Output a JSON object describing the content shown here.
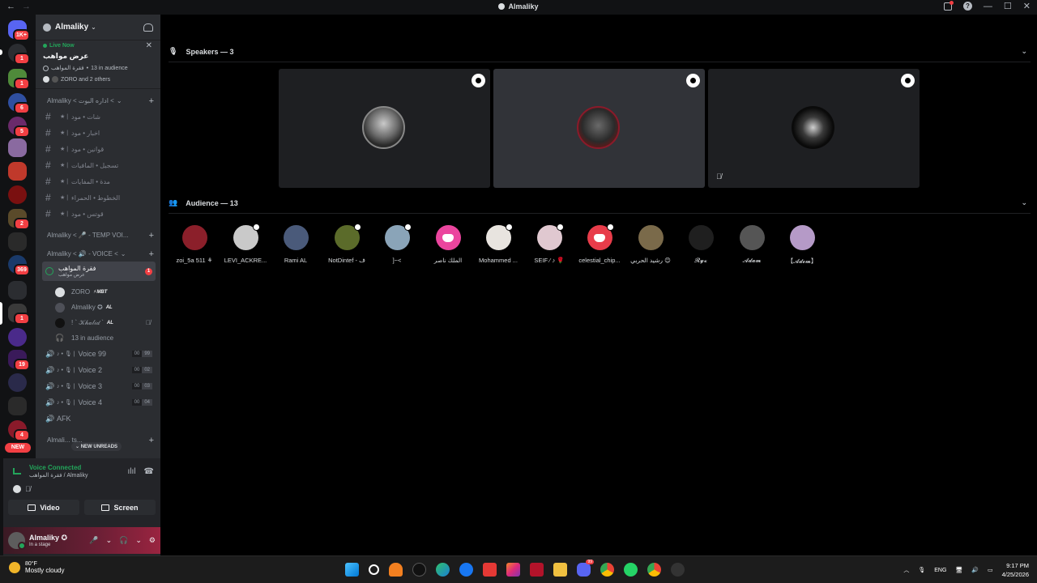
{
  "window": {
    "title": "Almaliky"
  },
  "server_rail": {
    "top_badge": "1K+",
    "badges": [
      "1",
      "1",
      "6",
      "5",
      "2",
      "369",
      "1",
      "19",
      "4"
    ],
    "new_label": "NEW"
  },
  "server": {
    "name": "Almaliky"
  },
  "live_now": {
    "label": "Live Now",
    "title": "عرض مواهب",
    "channel": "فقرة المواهب",
    "audience": "13 in audience",
    "people": "ZORO and 2 others"
  },
  "categories": {
    "admin": "Almaliky < اداره البوت <",
    "temp": "Almaliky < 🎤 - TEMP VOI...",
    "voice": "Almaliky < 🔊 - VOICE <",
    "bottom": "Almali... ts..."
  },
  "text_channels": [
    "شات • مود",
    "اخبار • مود",
    "قوانين • مود",
    "تسجيل • المافيات",
    "مدة • المفايات",
    "الخطوط • الحمراء",
    "قوتس • مود"
  ],
  "stage_channel": {
    "name": "فقرة المواهب",
    "topic": "عرض مواهب",
    "unread": "1"
  },
  "stage_members": [
    {
      "name": "ZORO",
      "tag": "⚡MBT"
    },
    {
      "name": "Almaliky ✪",
      "tag": "AL"
    },
    {
      "name": "! ` 𝒦𝒽𝒶𝓁𝒾𝒹 `",
      "tag": "AL"
    }
  ],
  "stage_audience_line": "13 in audience",
  "voice_channels": [
    {
      "name": "Voice 99",
      "count": "00",
      "limit": "99"
    },
    {
      "name": "Voice 2",
      "count": "00",
      "limit": "02"
    },
    {
      "name": "Voice 3",
      "count": "00",
      "limit": "03"
    },
    {
      "name": "Voice 4",
      "count": "00",
      "limit": "04"
    }
  ],
  "afk_channel": "AFK",
  "new_unreads": "NEW UNREADS",
  "voice_panel": {
    "status": "Voice Connected",
    "location": "فقرة المواهب / Almaliky",
    "video_label": "Video",
    "screen_label": "Screen"
  },
  "user": {
    "name": "Almaliky ✪",
    "status": "In a stage"
  },
  "speakers": {
    "header": "Speakers — 3"
  },
  "audience": {
    "header": "Audience — 13",
    "members": [
      {
        "name": "zoi_5a 511 ⚘",
        "color": "#8b1f2a"
      },
      {
        "name": "LEVI_ACKRE...",
        "color": "#c9c9c9"
      },
      {
        "name": "Rami AL",
        "color": "#4a5a7a"
      },
      {
        "name": "NotDintef - ف",
        "color": "#5b6b2a"
      },
      {
        "name": "]~<",
        "color": "#8aa4b8"
      },
      {
        "name": "الملك ناصر",
        "color": "#eb459e"
      },
      {
        "name": "Mohammed ...",
        "color": "#e8e4df"
      },
      {
        "name": "SEIF ⁄ ♪ 🌹",
        "color": "#e0c8d0"
      },
      {
        "name": "celestial_chip...",
        "color": "#e83c4a"
      },
      {
        "name": "رشيد الحربي 😊",
        "color": "#7a6a4a"
      },
      {
        "name": "𝓡𝔂𝔁",
        "color": "#1f1f1f"
      },
      {
        "name": "𝓐𝓭𝓪𝓶",
        "color": "#555555"
      },
      {
        "name": "【𝓐𝓭𝓸𝓶】",
        "color": "#b59ac7"
      }
    ]
  },
  "taskbar": {
    "weather_temp": "80°F",
    "weather_desc": "Mostly cloudy",
    "language": "ENG",
    "time": "9:17 PM",
    "date": "4/25/2026",
    "discord_badge": "99"
  }
}
